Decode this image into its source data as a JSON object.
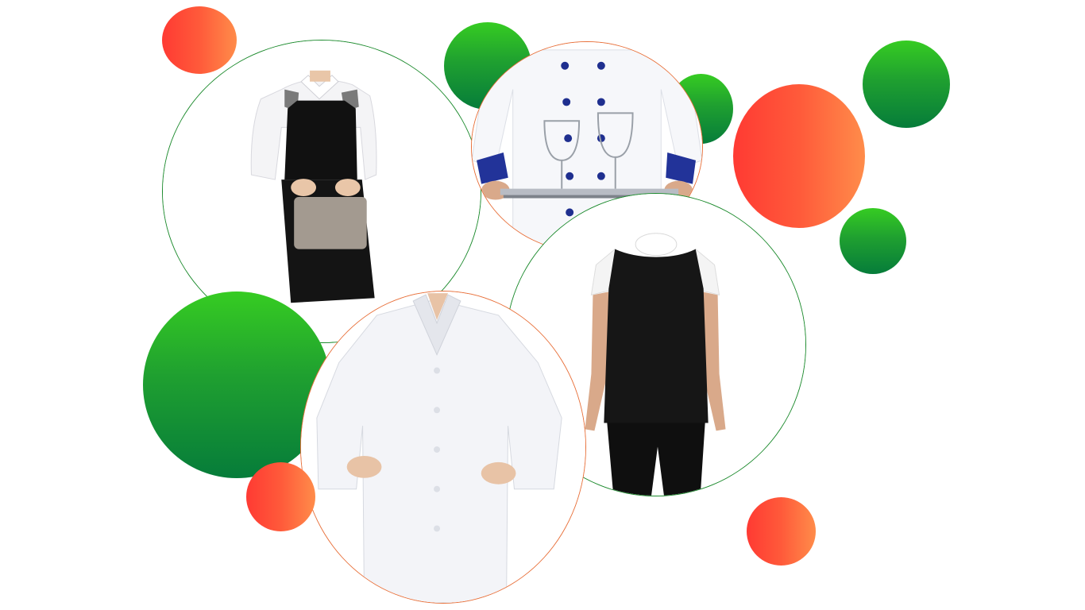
{
  "colors": {
    "green_top": "#36cc22",
    "green_bottom": "#067c3a",
    "orange_left": "#ff3a33",
    "orange_right": "#ff8c4a",
    "background": "#ffffff"
  },
  "photos": [
    {
      "name": "apron-uniform-photo",
      "subject": "black-apron-with-grey-pocket"
    },
    {
      "name": "chef-jacket-photo",
      "subject": "white-chef-jacket-with-tray-and-glasses"
    },
    {
      "name": "black-tunic-photo",
      "subject": "black-sleeveless-tunic-with-white-blouse"
    },
    {
      "name": "white-lab-coat-photo",
      "subject": "white-long-coat"
    }
  ]
}
